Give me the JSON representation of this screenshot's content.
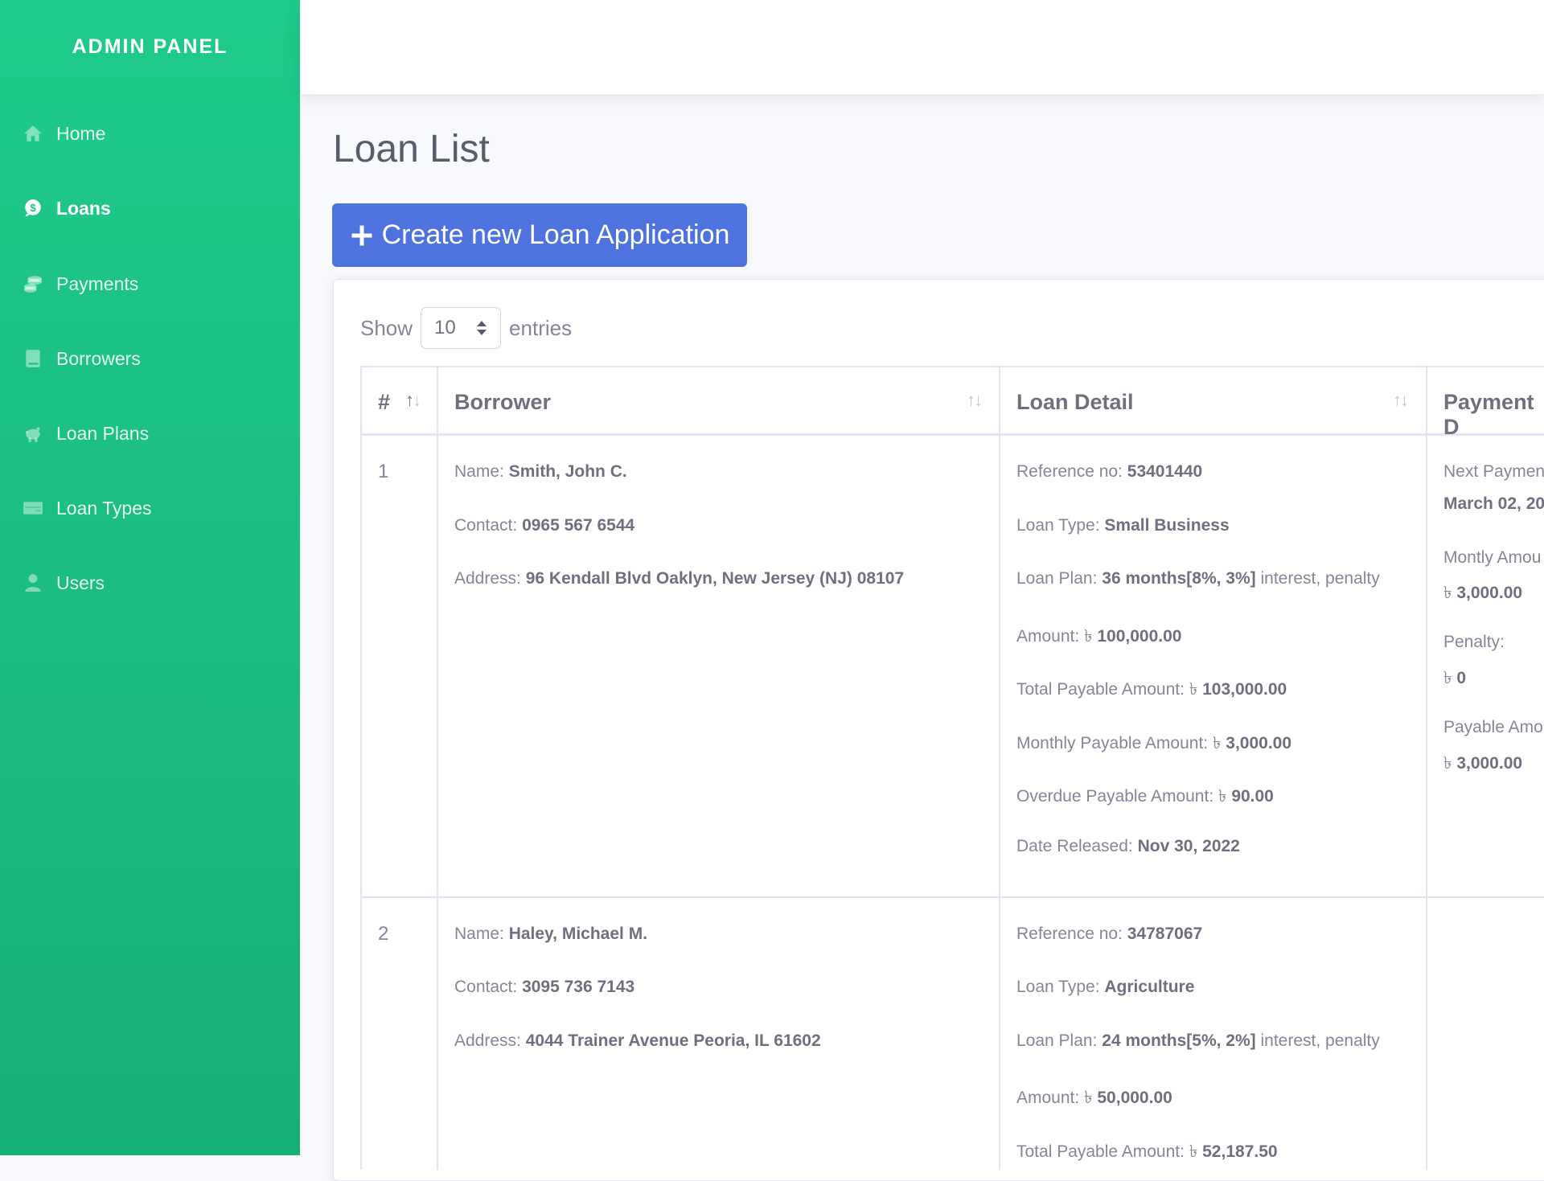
{
  "sidebar": {
    "brand": "ADMIN PANEL",
    "items": [
      {
        "label": "Home",
        "icon": "home-icon"
      },
      {
        "label": "Loans",
        "icon": "dollar-icon",
        "active": true
      },
      {
        "label": "Payments",
        "icon": "coins-icon"
      },
      {
        "label": "Borrowers",
        "icon": "book-icon"
      },
      {
        "label": "Loan Plans",
        "icon": "piggy-bank-icon"
      },
      {
        "label": "Loan Types",
        "icon": "money-bill-icon"
      },
      {
        "label": "Users",
        "icon": "user-icon"
      }
    ]
  },
  "page": {
    "title": "Loan List",
    "create_button": "Create new Loan Application"
  },
  "table_controls": {
    "show_label": "Show",
    "entries_value": "10",
    "entries_label": "entries"
  },
  "table": {
    "headers": {
      "num": "#",
      "borrower": "Borrower",
      "loan_detail": "Loan Detail",
      "payment_detail": "Payment D"
    },
    "rows": [
      {
        "num": "1",
        "borrower": {
          "name_label": "Name:",
          "name": "Smith, John C.",
          "contact_label": "Contact:",
          "contact": "0965 567 6544",
          "address_label": "Address:",
          "address": "96 Kendall Blvd Oaklyn, New Jersey (NJ) 08107"
        },
        "loan": {
          "ref_label": "Reference no:",
          "ref": "53401440",
          "type_label": "Loan Type:",
          "type": "Small Business",
          "plan_label": "Loan Plan:",
          "plan": "36 months[8%, 3%]",
          "plan_suffix": "interest, penalty",
          "amount_label": "Amount:",
          "currency": "৳",
          "amount": "100,000.00",
          "total_label": "Total Payable Amount:",
          "total": "103,000.00",
          "monthly_label": "Monthly Payable Amount:",
          "monthly": "3,000.00",
          "overdue_label": "Overdue Payable Amount:",
          "overdue": "90.00",
          "date_label": "Date Released:",
          "date": "Nov 30, 2022"
        },
        "payment": {
          "next_label": "Next Payment",
          "next": "March 02, 20",
          "monthly_label": "Montly Amou",
          "monthly": "3,000.00",
          "penalty_label": "Penalty:",
          "penalty": "0",
          "payable_label": "Payable Amou",
          "payable": "3,000.00"
        }
      },
      {
        "num": "2",
        "borrower": {
          "name_label": "Name:",
          "name": "Haley, Michael M.",
          "contact_label": "Contact:",
          "contact": "3095 736 7143",
          "address_label": "Address:",
          "address": "4044 Trainer Avenue Peoria, IL 61602"
        },
        "loan": {
          "ref_label": "Reference no:",
          "ref": "34787067",
          "type_label": "Loan Type:",
          "type": "Agriculture",
          "plan_label": "Loan Plan:",
          "plan": "24 months[5%, 2%]",
          "plan_suffix": "interest, penalty",
          "amount_label": "Amount:",
          "currency": "৳",
          "amount": "50,000.00",
          "total_label": "Total Payable Amount:",
          "total": "52,187.50"
        }
      }
    ]
  }
}
